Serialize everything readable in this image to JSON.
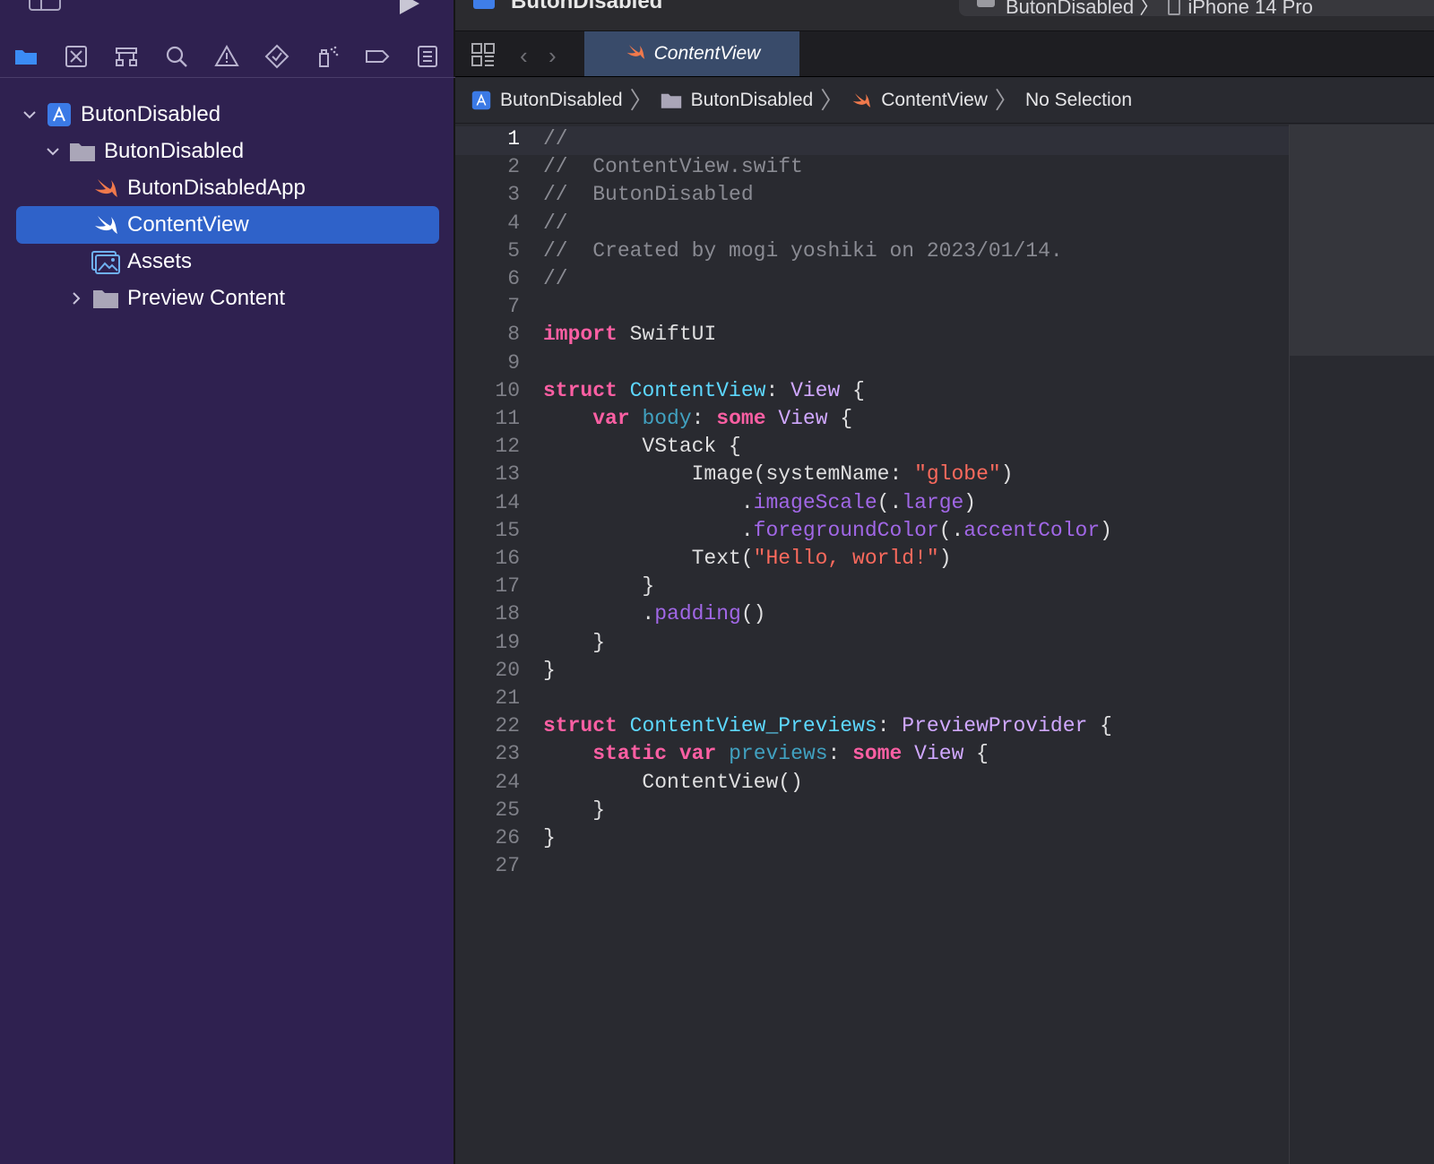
{
  "colors": {
    "sidebar_bg": "#2f2150",
    "selection": "#2f62c9",
    "editor_bg": "#292a30",
    "keyword": "#fc5fa3",
    "comment": "#8a8b93",
    "string": "#fc6a5d",
    "type": "#d0a8ff",
    "declaration": "#5dd8ff",
    "method": "#a167e6"
  },
  "toolbar": {
    "title": "ButonDisabled",
    "scheme": "ButonDisabled",
    "scheme_separator": "〉",
    "destination": "iPhone 14 Pro"
  },
  "navigator": {
    "tabs": [
      {
        "icon": "folder-icon"
      },
      {
        "icon": "source-control-icon"
      },
      {
        "icon": "symbol-hierarchy-icon"
      },
      {
        "icon": "search-icon"
      },
      {
        "icon": "warning-icon"
      },
      {
        "icon": "test-diamond-icon"
      },
      {
        "icon": "debug-spray-icon"
      },
      {
        "icon": "breakpoint-icon"
      },
      {
        "icon": "report-icon"
      }
    ],
    "tree": [
      {
        "label": "ButonDisabled",
        "icon": "project-icon",
        "chevron": "expanded"
      },
      {
        "label": "ButonDisabled",
        "icon": "folder-icon",
        "chevron": "expanded"
      },
      {
        "label": "ButonDisabledApp",
        "icon": "swift-file-icon"
      },
      {
        "label": "ContentView",
        "icon": "swift-file-icon",
        "selected": true
      },
      {
        "label": "Assets",
        "icon": "asset-catalog-icon"
      },
      {
        "label": "Preview Content",
        "icon": "folder-icon",
        "chevron": "collapsed"
      }
    ]
  },
  "editor": {
    "tab_label": "ContentView",
    "jumpbar": [
      "ButonDisabled",
      "ButonDisabled",
      "ContentView",
      "No Selection"
    ],
    "current_line": 1,
    "lines": [
      [
        [
          "c",
          "//"
        ]
      ],
      [
        [
          "c",
          "//  ContentView.swift"
        ]
      ],
      [
        [
          "c",
          "//  ButonDisabled"
        ]
      ],
      [
        [
          "c",
          "//"
        ]
      ],
      [
        [
          "c",
          "//  Created by mogi yoshiki on 2023/01/14."
        ]
      ],
      [
        [
          "c",
          "//"
        ]
      ],
      [],
      [
        [
          "k",
          "import"
        ],
        [
          "p",
          " SwiftUI"
        ]
      ],
      [],
      [
        [
          "k",
          "struct"
        ],
        [
          "p",
          " "
        ],
        [
          "dn",
          "ContentView"
        ],
        [
          "p",
          ": "
        ],
        [
          "ty",
          "View"
        ],
        [
          "p",
          " {"
        ]
      ],
      [
        [
          "p",
          "    "
        ],
        [
          "k",
          "var"
        ],
        [
          "p",
          " "
        ],
        [
          "dv",
          "body"
        ],
        [
          "p",
          ": "
        ],
        [
          "k",
          "some"
        ],
        [
          "p",
          " "
        ],
        [
          "ty",
          "View"
        ],
        [
          "p",
          " {"
        ]
      ],
      [
        [
          "p",
          "        VStack {"
        ]
      ],
      [
        [
          "p",
          "            Image(systemName: "
        ],
        [
          "s",
          "\"globe\""
        ],
        [
          "p",
          ")"
        ]
      ],
      [
        [
          "p",
          "                ."
        ],
        [
          "m",
          "imageScale"
        ],
        [
          "p",
          "(."
        ],
        [
          "m",
          "large"
        ],
        [
          "p",
          ")"
        ]
      ],
      [
        [
          "p",
          "                ."
        ],
        [
          "m",
          "foregroundColor"
        ],
        [
          "p",
          "(."
        ],
        [
          "m",
          "accentColor"
        ],
        [
          "p",
          ")"
        ]
      ],
      [
        [
          "p",
          "            Text("
        ],
        [
          "s",
          "\"Hello, world!\""
        ],
        [
          "p",
          ")"
        ]
      ],
      [
        [
          "p",
          "        }"
        ]
      ],
      [
        [
          "p",
          "        ."
        ],
        [
          "m",
          "padding"
        ],
        [
          "p",
          "()"
        ]
      ],
      [
        [
          "p",
          "    }"
        ]
      ],
      [
        [
          "p",
          "}"
        ]
      ],
      [],
      [
        [
          "k",
          "struct"
        ],
        [
          "p",
          " "
        ],
        [
          "dn",
          "ContentView_Previews"
        ],
        [
          "p",
          ": "
        ],
        [
          "ty",
          "PreviewProvider"
        ],
        [
          "p",
          " {"
        ]
      ],
      [
        [
          "p",
          "    "
        ],
        [
          "k",
          "static"
        ],
        [
          "p",
          " "
        ],
        [
          "k",
          "var"
        ],
        [
          "p",
          " "
        ],
        [
          "dv",
          "previews"
        ],
        [
          "p",
          ": "
        ],
        [
          "k",
          "some"
        ],
        [
          "p",
          " "
        ],
        [
          "ty",
          "View"
        ],
        [
          "p",
          " {"
        ]
      ],
      [
        [
          "p",
          "        ContentView()"
        ]
      ],
      [
        [
          "p",
          "    }"
        ]
      ],
      [
        [
          "p",
          "}"
        ]
      ],
      []
    ]
  }
}
